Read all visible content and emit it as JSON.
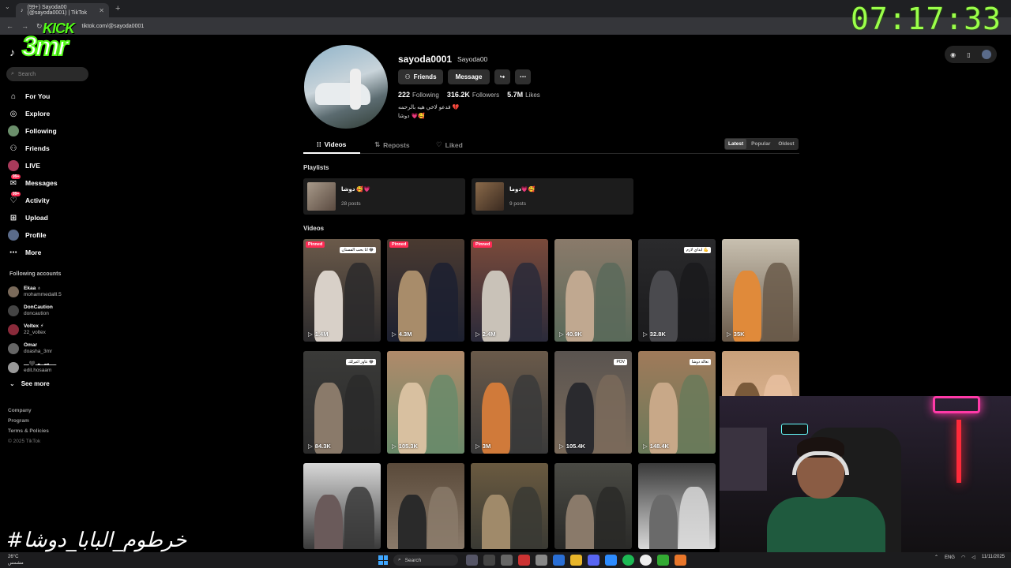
{
  "browser": {
    "tab_title": "(99+) Sayoda00 (@sayoda0001) | TikTok",
    "url": "tiktok.com/@sayoda0001"
  },
  "overlay": {
    "clock": "07:17:33",
    "kick_top": "KICK",
    "kick_bottom": "3mr",
    "hashtag": "#خرطوم_البابا_دوشا"
  },
  "sidebar": {
    "search_placeholder": "Search",
    "nav": [
      {
        "label": "For You",
        "icon": "home-icon"
      },
      {
        "label": "Explore",
        "icon": "compass-icon"
      },
      {
        "label": "Following",
        "icon": "following-avatar-icon"
      },
      {
        "label": "Friends",
        "icon": "friends-icon"
      },
      {
        "label": "LIVE",
        "icon": "live-icon"
      },
      {
        "label": "Messages",
        "icon": "messages-icon",
        "badge": "99+"
      },
      {
        "label": "Activity",
        "icon": "activity-icon",
        "badge": "99+"
      },
      {
        "label": "Upload",
        "icon": "upload-icon"
      },
      {
        "label": "Profile",
        "icon": "profile-avatar-icon"
      },
      {
        "label": "More",
        "icon": "more-icon"
      }
    ],
    "following_title": "Following accounts",
    "accounts": [
      {
        "name": "Ekaa ♁",
        "handle": "mohammedalll.5"
      },
      {
        "name": "DonCaution",
        "handle": "doncaution"
      },
      {
        "name": "Voltex ⚡",
        "handle": "22_voltex"
      },
      {
        "name": "Omar",
        "handle": "doasha_3mr"
      },
      {
        "name": "ــــســمـ🖤ـــ",
        "handle": "edit.hosaam"
      }
    ],
    "see_more": "See more",
    "footer": [
      "Company",
      "Program",
      "Terms & Policies"
    ],
    "copyright": "© 2025 TikTok"
  },
  "profile": {
    "username": "sayoda0001",
    "nickname": "Sayoda00",
    "friends_btn": "Friends",
    "message_btn": "Message",
    "following_count": "222",
    "following_label": "Following",
    "followers_count": "316.2K",
    "followers_label": "Followers",
    "likes_count": "5.7M",
    "likes_label": "Likes",
    "bio_line1": "فدعو لاخي هيه بالرحمه 💔",
    "bio_line2": "دوشا 💗🥰"
  },
  "tabs": {
    "videos": "Videos",
    "reposts": "Reposts",
    "liked": "Liked",
    "sort": [
      "Latest",
      "Popular",
      "Oldest"
    ]
  },
  "sections": {
    "playlists": "Playlists",
    "videos": "Videos"
  },
  "playlists": [
    {
      "title": "دوشا 🥰💗",
      "count": "28 posts"
    },
    {
      "title": "دوما💗🥰",
      "count": "9 posts"
    }
  ],
  "videos": [
    {
      "views": "1.4M",
      "pinned": "Pinned",
      "caption": "انا بحب الفستان 😂"
    },
    {
      "views": "4.3M",
      "pinned": "Pinned",
      "caption": ""
    },
    {
      "views": "2.4M",
      "pinned": "Pinned",
      "caption": ""
    },
    {
      "views": "40.9K",
      "pinned": "",
      "caption": ""
    },
    {
      "views": "32.8K",
      "pinned": "",
      "caption": "ابداي لازم 💪"
    },
    {
      "views": "35K",
      "pinned": "",
      "caption": ""
    },
    {
      "views": "84.3K",
      "pinned": "",
      "caption": "عاوز اغيرلك 😂"
    },
    {
      "views": "105.3K",
      "pinned": "",
      "caption": ""
    },
    {
      "views": "3M",
      "pinned": "",
      "caption": ""
    },
    {
      "views": "105.4K",
      "pinned": "",
      "caption": "POV"
    },
    {
      "views": "148.4K",
      "pinned": "",
      "caption": "تعالة دوشا"
    },
    {
      "views": "",
      "pinned": "",
      "caption": ""
    },
    {
      "views": "",
      "pinned": "",
      "caption": ""
    },
    {
      "views": "",
      "pinned": "",
      "caption": ""
    },
    {
      "views": "",
      "pinned": "",
      "caption": ""
    },
    {
      "views": "",
      "pinned": "",
      "caption": ""
    },
    {
      "views": "",
      "pinned": "",
      "caption": ""
    }
  ],
  "taskbar": {
    "weather_temp": "26°C",
    "weather_desc": "مشمس",
    "search": "Search",
    "lang": "ENG",
    "date": "11/11/2025"
  }
}
